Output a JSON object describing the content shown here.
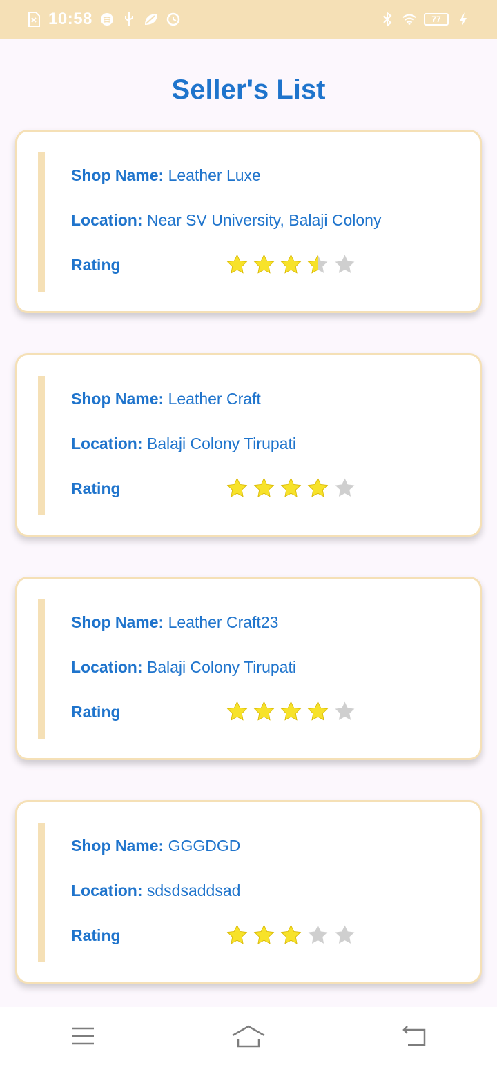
{
  "status_bar": {
    "time": "10:58",
    "battery": "77",
    "left_icons": [
      "no-sim-icon",
      "spotify-icon",
      "usb-icon",
      "leaf-icon",
      "sync-icon"
    ],
    "right_icons": [
      "bluetooth-icon",
      "wifi-icon",
      "battery-icon",
      "charging-icon"
    ]
  },
  "page": {
    "title": "Seller's List"
  },
  "labels": {
    "shop_name": "Shop Name:",
    "location": "Location:",
    "rating": "Rating"
  },
  "sellers": [
    {
      "shop_name": "Leather Luxe",
      "location": "Near SV University, Balaji Colony",
      "rating": 3.5
    },
    {
      "shop_name": "Leather Craft",
      "location": "Balaji Colony Tirupati",
      "rating": 4
    },
    {
      "shop_name": "Leather Craft23",
      "location": "Balaji Colony Tirupati",
      "rating": 4
    },
    {
      "shop_name": "GGGDGD",
      "location": "sdsdsaddsad",
      "rating": 3
    }
  ],
  "colors": {
    "accent": "#1f74cc",
    "card_border": "#f5e0b6",
    "star_filled": "#f7e22a",
    "star_empty": "#cfcfcf"
  },
  "nav_bar": {
    "icons": [
      "menu-icon",
      "home-icon",
      "back-icon"
    ]
  }
}
